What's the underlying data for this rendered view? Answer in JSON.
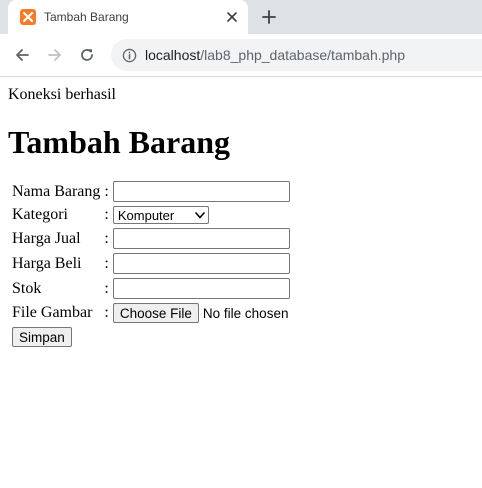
{
  "browser": {
    "tab": {
      "title": "Tambah Barang"
    },
    "address_bar": {
      "host": "localhost",
      "path": "/lab8_php_database/tambah.php"
    }
  },
  "page": {
    "status_message": "Koneksi berhasil",
    "heading": "Tambah Barang",
    "form": {
      "separator": ":",
      "fields": {
        "nama": {
          "label": "Nama Barang",
          "value": ""
        },
        "kategori": {
          "label": "Kategori",
          "selected": "Komputer"
        },
        "harga_jual": {
          "label": "Harga Jual",
          "value": ""
        },
        "harga_beli": {
          "label": "Harga Beli",
          "value": ""
        },
        "stok": {
          "label": "Stok",
          "value": ""
        },
        "gambar": {
          "label": "File Gambar",
          "button_label": "Choose File",
          "status": "No file chosen"
        }
      },
      "submit_label": "Simpan"
    }
  }
}
